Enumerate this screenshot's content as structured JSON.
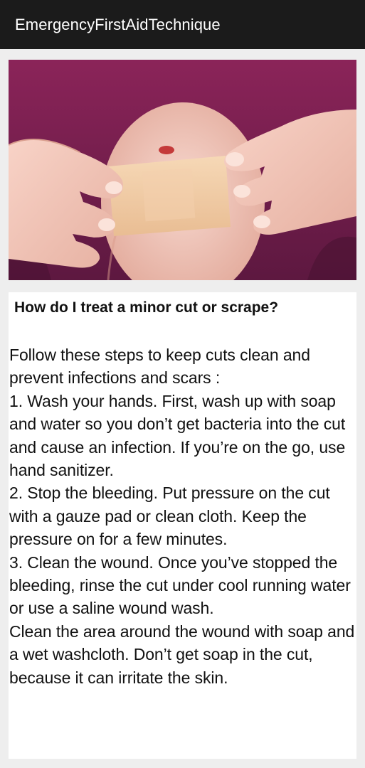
{
  "app_bar": {
    "title": "EmergencyFirstAidTechnique"
  },
  "hero_image": {
    "icon": "bandage-on-knee-photo",
    "colors": {
      "shirt": "#7a1f4f",
      "skin": "#f2c7bd",
      "bandage": "#f1cca6"
    }
  },
  "article": {
    "title": "How do I treat a minor cut or scrape?",
    "paragraphs": [
      " Follow these steps to keep cuts clean and prevent infections and scars :",
      " 1. Wash your hands. First, wash up with soap and water so you don’t get bacteria into the cut and cause an infection. If you’re on the go, use hand sanitizer.",
      " 2. Stop the bleeding. Put pressure on the cut with a gauze pad or clean cloth. Keep the pressure on for a few minutes.",
      " 3. Clean the wound. Once you’ve stopped the bleeding, rinse the cut under cool running water or use a saline wound wash.",
      " Clean the area around the wound with soap and a wet washcloth. Don’t get soap in the cut, because it can irritate the skin."
    ]
  }
}
